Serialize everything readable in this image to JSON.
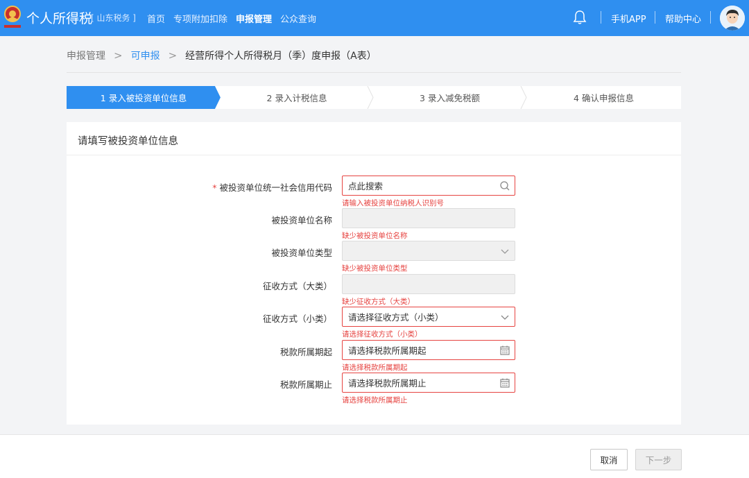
{
  "header": {
    "title": "个人所得税",
    "region": "[ 山东税务 ]",
    "nav": [
      "首页",
      "专项附加扣除",
      "申报管理",
      "公众查询"
    ],
    "nav_active_index": 2,
    "mobile_app": "手机APP",
    "help_center": "帮助中心",
    "brand_color": "#2f8ff0"
  },
  "breadcrumb": {
    "level1": "申报管理",
    "level2": "可申报",
    "level3": "经营所得个人所得税月（季）度申报（A表）",
    "separator": ">"
  },
  "steps": [
    {
      "label": "1 录入被投资单位信息",
      "active": true
    },
    {
      "label": "2 录入计税信息",
      "active": false
    },
    {
      "label": "3 录入减免税额",
      "active": false
    },
    {
      "label": "4 确认申报信息",
      "active": false
    }
  ],
  "form": {
    "section_title": "请填写被投资单位信息",
    "fields": [
      {
        "label": "被投资单位统一社会信用代码",
        "required": true,
        "value": "点此搜索",
        "icon": "search-icon",
        "error": "请输入被投资单位纳税人识别号",
        "disabled": false
      },
      {
        "label": "被投资单位名称",
        "required": false,
        "value": "",
        "icon": "",
        "error": "缺少被投资单位名称",
        "disabled": true
      },
      {
        "label": "被投资单位类型",
        "required": false,
        "value": "",
        "icon": "chevron-down-icon",
        "error": "缺少被投资单位类型",
        "disabled": true
      },
      {
        "label": "征收方式（大类）",
        "required": false,
        "value": "",
        "icon": "",
        "error": "缺少征收方式（大类）",
        "disabled": true
      },
      {
        "label": "征收方式（小类）",
        "required": false,
        "value": "请选择征收方式（小类）",
        "icon": "chevron-down-icon",
        "error": "请选择征收方式（小类）",
        "disabled": false
      },
      {
        "label": "税款所属期起",
        "required": false,
        "value": "请选择税款所属期起",
        "icon": "calendar-icon",
        "error": "请选择税款所属期起",
        "disabled": false
      },
      {
        "label": "税款所属期止",
        "required": false,
        "value": "请选择税款所属期止",
        "icon": "calendar-icon",
        "error": "请选择税款所属期止",
        "disabled": false
      }
    ]
  },
  "footer": {
    "cancel": "取消",
    "next": "下一步"
  }
}
